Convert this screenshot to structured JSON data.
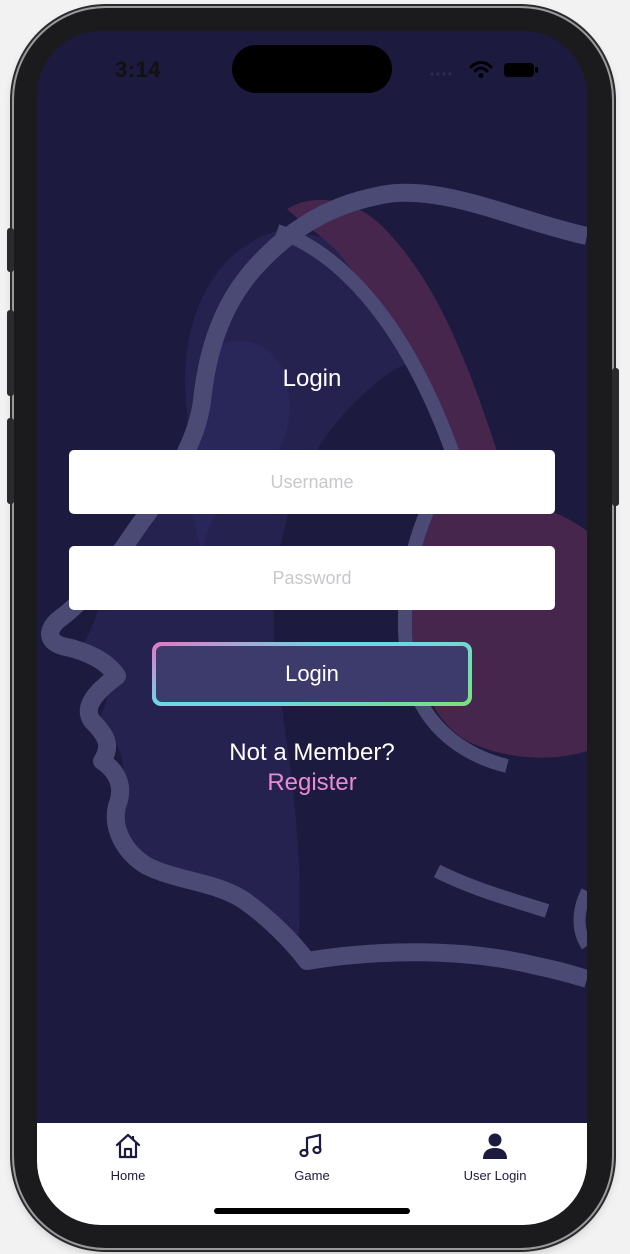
{
  "status_bar": {
    "time": "3:14"
  },
  "login": {
    "title": "Login",
    "username_placeholder": "Username",
    "password_placeholder": "Password",
    "login_button": "Login",
    "not_member": "Not a Member?",
    "register_link": "Register"
  },
  "tabs": [
    {
      "label": "Home",
      "icon": "home-icon"
    },
    {
      "label": "Game",
      "icon": "music-note-icon"
    },
    {
      "label": "User Login",
      "icon": "user-icon",
      "active": true
    }
  ],
  "colors": {
    "background": "#1c1a3e",
    "button": "#3d3a6c",
    "register": "#e98bd3",
    "tabbar": "#ffffff"
  }
}
